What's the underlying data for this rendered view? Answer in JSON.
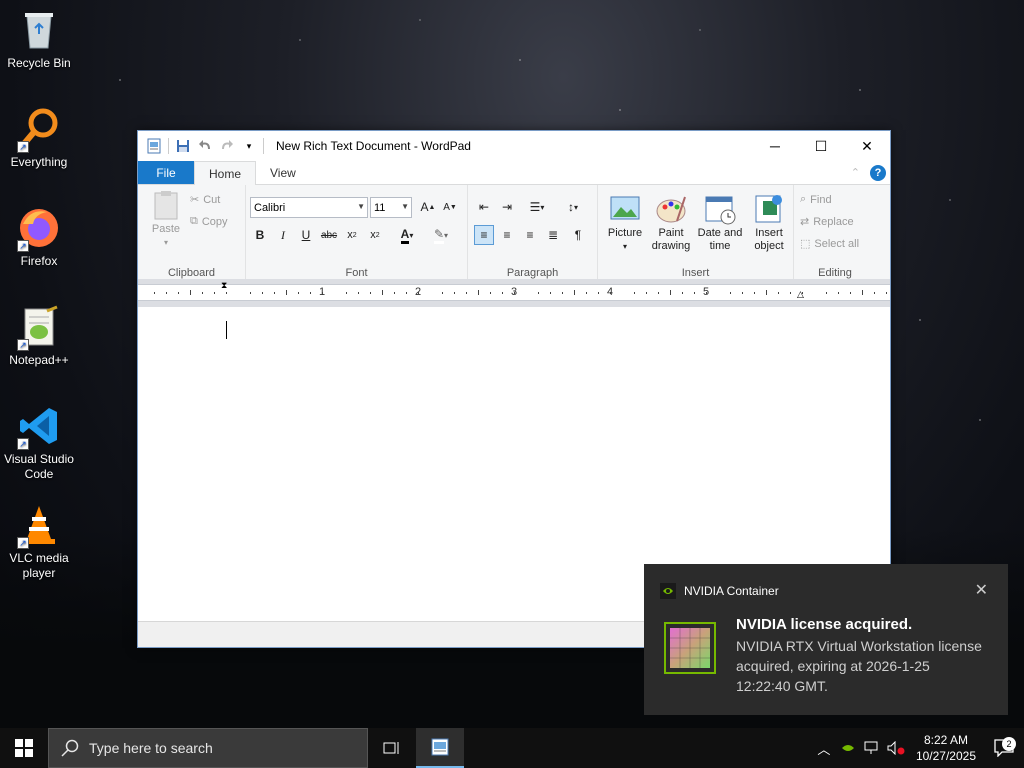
{
  "desktop": {
    "icons": [
      {
        "label": "Recycle Bin",
        "icon": "recycle-bin-icon"
      },
      {
        "label": "Everything",
        "icon": "everything-search-icon"
      },
      {
        "label": "Firefox",
        "icon": "firefox-icon"
      },
      {
        "label": "Notepad++",
        "icon": "notepadpp-icon"
      },
      {
        "label": "Visual Studio Code",
        "icon": "vscode-icon"
      },
      {
        "label": "VLC media player",
        "icon": "vlc-icon"
      }
    ]
  },
  "window": {
    "title": "New Rich Text Document - WordPad",
    "tabs": {
      "file": "File",
      "home": "Home",
      "view": "View"
    },
    "clipboard": {
      "label": "Clipboard",
      "paste": "Paste",
      "cut": "Cut",
      "copy": "Copy"
    },
    "font": {
      "label": "Font",
      "family": "Calibri",
      "size": "11"
    },
    "paragraph": {
      "label": "Paragraph"
    },
    "insert": {
      "label": "Insert",
      "picture": "Picture",
      "paint_1": "Paint",
      "paint_2": "drawing",
      "date_1": "Date and",
      "date_2": "time",
      "object_1": "Insert",
      "object_2": "object"
    },
    "editing": {
      "label": "Editing",
      "find": "Find",
      "replace": "Replace",
      "select_all": "Select all"
    },
    "ruler_numbers": [
      "1",
      "2",
      "3",
      "4",
      "5"
    ]
  },
  "toast": {
    "app": "NVIDIA Container",
    "title": "NVIDIA license acquired.",
    "body": "NVIDIA RTX Virtual Workstation license acquired, expiring at 2026-1-25 12:22:40 GMT."
  },
  "taskbar": {
    "search_placeholder": "Type here to search",
    "time": "8:22 AM",
    "date": "10/27/2025",
    "notification_count": "2"
  },
  "colors": {
    "accent": "#1979ca",
    "nvidia": "#76b900"
  }
}
